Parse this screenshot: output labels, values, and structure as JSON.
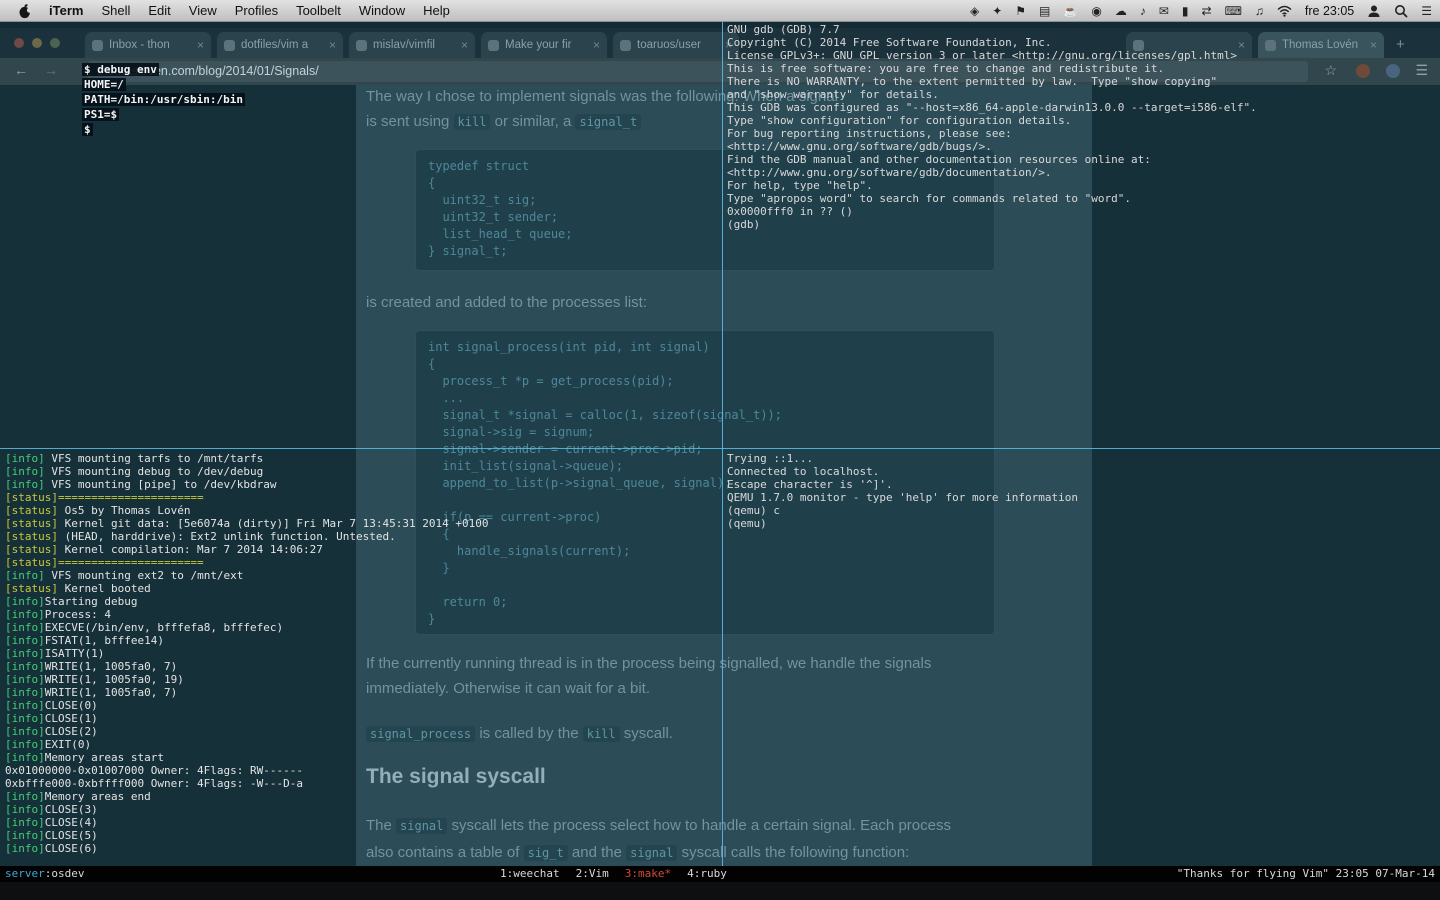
{
  "menubar": {
    "menus": [
      {
        "t": "iTerm",
        "cls": "bold"
      },
      {
        "t": "Shell"
      },
      {
        "t": "Edit"
      },
      {
        "t": "View"
      },
      {
        "t": "Profiles"
      },
      {
        "t": "Toolbelt"
      },
      {
        "t": "Window"
      },
      {
        "t": "Help"
      }
    ],
    "status_icons": [
      {
        "name": "controller-icon",
        "g": "◈"
      },
      {
        "name": "dropbox-icon",
        "g": "✦"
      },
      {
        "name": "flag-icon",
        "g": "⚑"
      },
      {
        "name": "display-icon",
        "g": "▤"
      },
      {
        "name": "cup-icon",
        "g": "☕"
      },
      {
        "name": "record-icon",
        "g": "◉"
      },
      {
        "name": "cloud-icon",
        "g": "☁"
      },
      {
        "name": "music-icon",
        "g": "♪"
      },
      {
        "name": "mail-icon",
        "g": "✉"
      },
      {
        "name": "battery-icon",
        "g": "▮"
      },
      {
        "name": "sync-icon",
        "g": "⇄"
      },
      {
        "name": "keyboard-icon",
        "g": "⌨"
      },
      {
        "name": "volume-icon",
        "g": "♫"
      }
    ],
    "clock": "fre 23:05",
    "notification_glyph": "☰"
  },
  "browser": {
    "tabs": [
      {
        "title": "Inbox - thon"
      },
      {
        "title": "dotfiles/vim a"
      },
      {
        "title": "mislav/vimfil"
      },
      {
        "title": "Make your fir"
      },
      {
        "title": "toaruos/user"
      },
      {
        "title": "",
        "cls": "gap"
      },
      {
        "title": "Thomas Lovén",
        "cls": "current"
      }
    ],
    "icons": {
      "back": "←",
      "forward": "→",
      "star": "☆",
      "menu_burger": "☰",
      "new_tab": "+",
      "close_tab": "×"
    },
    "url": "thomasloven.com/blog/2014/01/Signals/",
    "page": {
      "para1_l1": [
        {
          "t": "The way I chose to implement signals was the following: When a signal"
        }
      ],
      "para1_l2": [
        {
          "t": "is sent using "
        },
        {
          "t": "kill",
          "cls": "chip"
        },
        {
          "t": " or similar, a "
        },
        {
          "t": "signal_t",
          "cls": "chip"
        }
      ],
      "code1": [
        "typedef struct",
        "{",
        "  uint32_t sig;",
        "  uint32_t sender;",
        "  list_head_t queue;",
        "} signal_t;"
      ],
      "para2": [
        {
          "t": "is created and added to the processes list:"
        }
      ],
      "code2": [
        "int signal_process(int pid, int signal)",
        "{",
        "  process_t *p = get_process(pid);",
        "  ...",
        "  signal_t *signal = calloc(1, sizeof(signal_t));",
        "  signal->sig = signum;",
        "  signal->sender = current->proc->pid;",
        "  init_list(signal->queue);",
        "  append_to_list(p->signal_queue, signal);",
        "",
        "  if(p == current->proc)",
        "  {",
        "    handle_signals(current);",
        "  }",
        "",
        "  return 0;",
        "}"
      ],
      "para3_l1": [
        {
          "t": "If the currently running thread is in the process being signalled, we handle the signals"
        }
      ],
      "para3_l2": [
        {
          "t": "immediately. Otherwise it can wait for a bit."
        }
      ],
      "para4": [
        {
          "t": "signal_process",
          "cls": "chip"
        },
        {
          "t": " is called by the "
        },
        {
          "t": "kill",
          "cls": "chip"
        },
        {
          "t": " syscall."
        }
      ],
      "heading": "The signal syscall",
      "para5_l1": [
        {
          "t": "The "
        },
        {
          "t": "signal",
          "cls": "chip"
        },
        {
          "t": " syscall lets the process select how to handle a certain signal. Each process"
        }
      ],
      "para5_l2": [
        {
          "t": "also contains a table of "
        },
        {
          "t": "sig_t",
          "cls": "chip"
        },
        {
          "t": " and the "
        },
        {
          "t": "signal",
          "cls": "chip"
        },
        {
          "t": " syscall calls the following function:"
        }
      ]
    }
  },
  "terminal": {
    "shell_pane": [
      "$ debug env",
      "HOME=/",
      "PATH=/bin:/usr/sbin:/bin",
      "PS1=$",
      "$"
    ],
    "gdb_pane": [
      "GNU gdb (GDB) 7.7",
      "Copyright (C) 2014 Free Software Foundation, Inc.",
      "License GPLv3+: GNU GPL version 3 or later <http://gnu.org/licenses/gpl.html>",
      "This is free software: you are free to change and redistribute it.",
      "There is NO WARRANTY, to the extent permitted by law.  Type \"show copying\"",
      "and \"show warranty\" for details.",
      "This GDB was configured as \"--host=x86_64-apple-darwin13.0.0 --target=i586-elf\".",
      "Type \"show configuration\" for configuration details.",
      "For bug reporting instructions, please see:",
      "<http://www.gnu.org/software/gdb/bugs/>.",
      "Find the GDB manual and other documentation resources online at:",
      "<http://www.gnu.org/software/gdb/documentation/>.",
      "For help, type \"help\".",
      "Type \"apropos word\" to search for commands related to \"word\".",
      "0x0000fff0 in ?? ()",
      "(gdb)"
    ],
    "kernel_pane": [
      {
        "tag": "[info]",
        "text": " VFS mounting tarfs to /mnt/tarfs",
        "cls": "info"
      },
      {
        "tag": "[info]",
        "text": " VFS mounting debug to /dev/debug",
        "cls": "info"
      },
      {
        "tag": "[info]",
        "text": " VFS mounting [pipe] to /dev/kbdraw",
        "cls": "info"
      },
      {
        "tag": "[status]",
        "text": "======================",
        "cls": "statusfull"
      },
      {
        "tag": "[status]",
        "text": " Os5 by Thomas Lovén",
        "cls": "status"
      },
      {
        "tag": "[status]",
        "text": " Kernel git data: [5e6074a (dirty)] Fri Mar 7 13:45:31 2014 +0100",
        "cls": "status"
      },
      {
        "tag": "[status]",
        "text": " (HEAD, harddrive): Ext2 unlink function. Untested.",
        "cls": "status"
      },
      {
        "tag": "[status]",
        "text": " Kernel compilation: Mar 7 2014 14:06:27",
        "cls": "status"
      },
      {
        "tag": "[status]",
        "text": "======================",
        "cls": "statusfull"
      },
      {
        "tag": "[info]",
        "text": " VFS mounting ext2 to /mnt/ext",
        "cls": "info"
      },
      {
        "tag": "[status]",
        "text": " Kernel booted",
        "cls": "status"
      },
      {
        "tag": "[info]",
        "text": "Starting debug",
        "cls": "info"
      },
      {
        "tag": "[info]",
        "text": "Process: 4",
        "cls": "info"
      },
      {
        "tag": "[info]",
        "text": "EXECVE(/bin/env, bfffefa8, bfffefec)",
        "cls": "info"
      },
      {
        "tag": "[info]",
        "text": "FSTAT(1, bfffee14)",
        "cls": "info"
      },
      {
        "tag": "[info]",
        "text": "ISATTY(1)",
        "cls": "info"
      },
      {
        "tag": "[info]",
        "text": "WRITE(1, 1005fa0, 7)",
        "cls": "info"
      },
      {
        "tag": "[info]",
        "text": "WRITE(1, 1005fa0, 19)",
        "cls": "info"
      },
      {
        "tag": "[info]",
        "text": "WRITE(1, 1005fa0, 7)",
        "cls": "info"
      },
      {
        "tag": "[info]",
        "text": "CLOSE(0)",
        "cls": "info"
      },
      {
        "tag": "[info]",
        "text": "CLOSE(1)",
        "cls": "info"
      },
      {
        "tag": "[info]",
        "text": "CLOSE(2)",
        "cls": "info"
      },
      {
        "tag": "[info]",
        "text": "EXIT(0)",
        "cls": "info"
      },
      {
        "tag": "[info]",
        "text": "Memory areas start",
        "cls": "info"
      },
      {
        "tag": "",
        "text": "0x01000000-0x01007000 Owner: 4Flags: RW------",
        "cls": "plain"
      },
      {
        "tag": "",
        "text": "0xbfffe000-0xbffff000 Owner: 4Flags: -W---D-a",
        "cls": "plain"
      },
      {
        "tag": "[info]",
        "text": "Memory areas end",
        "cls": "info"
      },
      {
        "tag": "[info]",
        "text": "CLOSE(3)",
        "cls": "info"
      },
      {
        "tag": "[info]",
        "text": "CLOSE(4)",
        "cls": "info"
      },
      {
        "tag": "[info]",
        "text": "CLOSE(5)",
        "cls": "info"
      },
      {
        "tag": "[info]",
        "text": "CLOSE(6)",
        "cls": "info"
      }
    ],
    "qemu_pane": [
      "Trying ::1...",
      "Connected to localhost.",
      "Escape character is '^]'.",
      "QEMU 1.7.0 monitor - type 'help' for more information",
      "(qemu) c",
      "(qemu)"
    ]
  },
  "tmux": {
    "left_label": "server",
    "left_sep": ":",
    "left_value": "osdev",
    "windows": [
      {
        "t": "1:weechat"
      },
      {
        "t": "2:Vim"
      },
      {
        "t": "3:make*",
        "cls": "active"
      },
      {
        "t": "4:ruby"
      }
    ],
    "right": "\"Thanks for flying Vim\" 23:05 07-Mar-14"
  },
  "colors": {
    "divider_cyan": "#55bbe2",
    "info_green": "#43cd78",
    "status_yellow": "#c9c93a",
    "active_red": "#d34a33",
    "tmux_server_cyan": "#3fa8dc"
  }
}
